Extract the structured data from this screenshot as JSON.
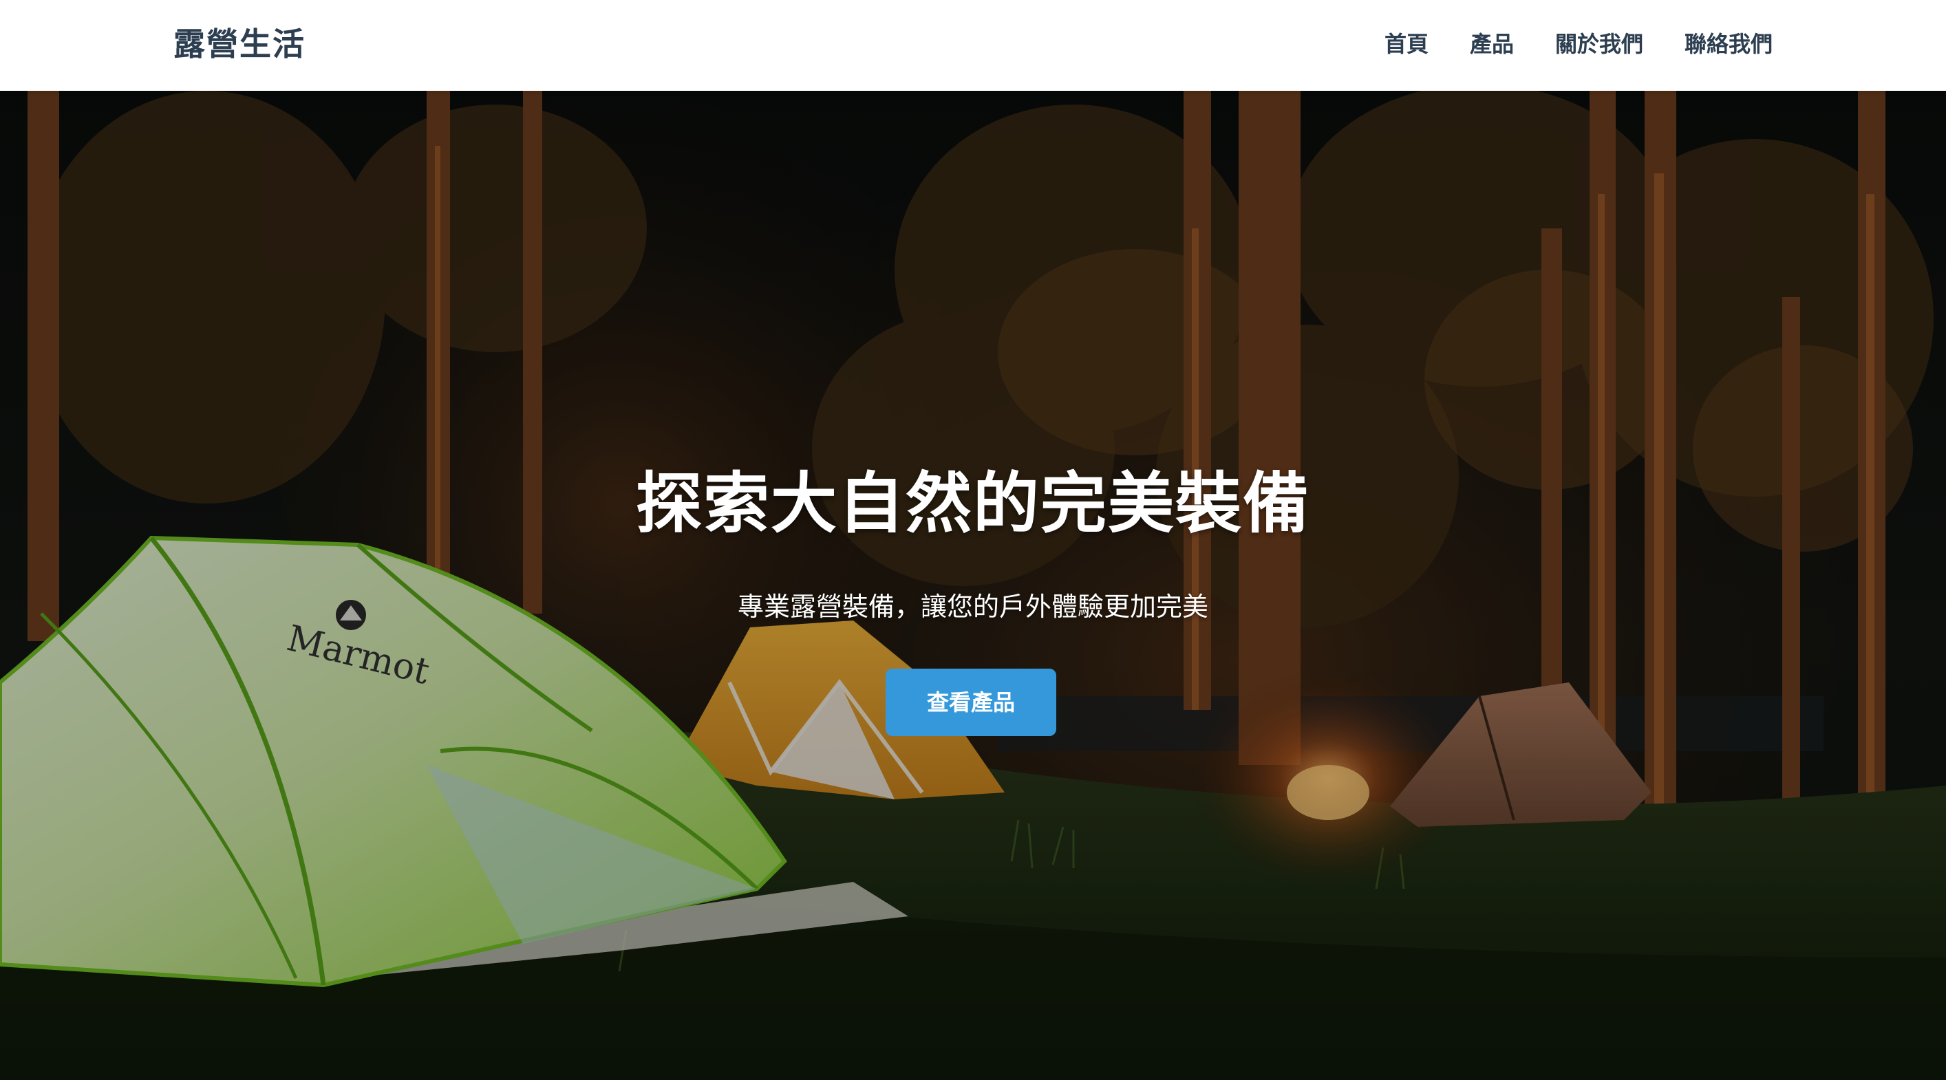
{
  "navbar": {
    "brand": "露營生活",
    "links": [
      {
        "label": "首頁"
      },
      {
        "label": "產品"
      },
      {
        "label": "關於我們"
      },
      {
        "label": "聯絡我們"
      }
    ]
  },
  "hero": {
    "title": "探索大自然的完美裝備",
    "subtitle": "專業露營裝備，讓您的戶外體驗更加完美",
    "cta_label": "查看產品",
    "tent_brand": "Marmot"
  },
  "colors": {
    "brand_text": "#2c3e50",
    "cta_background": "#3498db",
    "navbar_background": "#ffffff"
  }
}
